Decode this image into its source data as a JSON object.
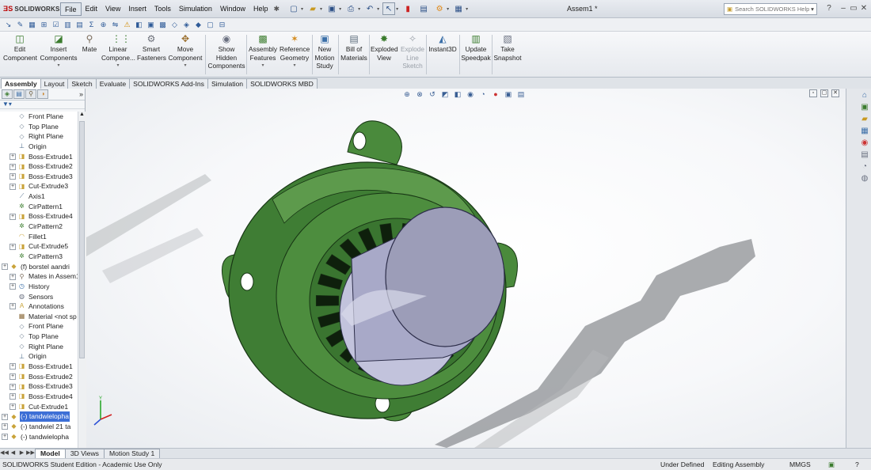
{
  "app": {
    "logo": "SOLIDWORKS",
    "document_title": "Assem1 *"
  },
  "menu": [
    "File",
    "Edit",
    "View",
    "Insert",
    "Tools",
    "Simulation",
    "Window",
    "Help"
  ],
  "search": {
    "placeholder": "Search SOLIDWORKS Help"
  },
  "command_manager": {
    "edit_component": "Edit Component",
    "insert_components": "Insert Components",
    "mate": "Mate",
    "linear_component": "Linear Compone...",
    "smart_fasteners": "Smart Fasteners",
    "move_component": "Move Component",
    "show_hidden": "Show Hidden Components",
    "assembly_features": "Assembly Features",
    "reference_geometry": "Reference Geometry",
    "new_motion_study": "New Motion Study",
    "bill_of_materials": "Bill of Materials",
    "exploded_view": "Exploded View",
    "explode_line_sketch": "Explode Line Sketch",
    "instant3d": "Instant3D",
    "update_speedpak": "Update Speedpak",
    "take_snapshot": "Take Snapshot"
  },
  "tabs": [
    "Assembly",
    "Layout",
    "Sketch",
    "Evaluate",
    "SOLIDWORKS Add-Ins",
    "Simulation",
    "SOLIDWORKS MBD"
  ],
  "tree": [
    {
      "label": "Front Plane",
      "icon": "plane-icon",
      "exp": false
    },
    {
      "label": "Top Plane",
      "icon": "plane-icon",
      "exp": false
    },
    {
      "label": "Right Plane",
      "icon": "plane-icon",
      "exp": false
    },
    {
      "label": "Origin",
      "icon": "origin-icon",
      "exp": false
    },
    {
      "label": "Boss-Extrude1",
      "icon": "feature-icon",
      "exp": true
    },
    {
      "label": "Boss-Extrude2",
      "icon": "feature-icon",
      "exp": true
    },
    {
      "label": "Boss-Extrude3",
      "icon": "feature-icon",
      "exp": true
    },
    {
      "label": "Cut-Extrude3",
      "icon": "feature-icon",
      "exp": true
    },
    {
      "label": "Axis1",
      "icon": "axis-icon",
      "exp": false
    },
    {
      "label": "CirPattern1",
      "icon": "pattern-icon",
      "exp": false
    },
    {
      "label": "Boss-Extrude4",
      "icon": "feature-icon",
      "exp": true
    },
    {
      "label": "CirPattern2",
      "icon": "pattern-icon",
      "exp": false
    },
    {
      "label": "Fillet1",
      "icon": "fillet-icon",
      "exp": false
    },
    {
      "label": "Cut-Extrude5",
      "icon": "feature-icon",
      "exp": true
    },
    {
      "label": "CirPattern3",
      "icon": "pattern-icon",
      "exp": false
    },
    {
      "label": "(f) borstel aandri",
      "icon": "part-icon",
      "exp": true
    },
    {
      "label": "Mates in Assem1",
      "icon": "mates-icon",
      "exp": true
    },
    {
      "label": "History",
      "icon": "history-icon",
      "exp": true
    },
    {
      "label": "Sensors",
      "icon": "sensor-icon",
      "exp": false
    },
    {
      "label": "Annotations",
      "icon": "annotation-icon",
      "exp": true
    },
    {
      "label": "Material <not sp",
      "icon": "material-icon",
      "exp": false
    },
    {
      "label": "Front Plane",
      "icon": "plane-icon",
      "exp": false
    },
    {
      "label": "Top Plane",
      "icon": "plane-icon",
      "exp": false
    },
    {
      "label": "Right Plane",
      "icon": "plane-icon",
      "exp": false
    },
    {
      "label": "Origin",
      "icon": "origin-icon",
      "exp": false
    },
    {
      "label": "Boss-Extrude1",
      "icon": "feature-icon",
      "exp": true
    },
    {
      "label": "Boss-Extrude2",
      "icon": "feature-icon",
      "exp": true
    },
    {
      "label": "Boss-Extrude3",
      "icon": "feature-icon",
      "exp": true
    },
    {
      "label": "Boss-Extrude4",
      "icon": "feature-icon",
      "exp": true
    },
    {
      "label": "Cut-Extrude1",
      "icon": "feature-icon",
      "exp": true
    },
    {
      "label": "(-) tandwielopha",
      "icon": "part-icon",
      "exp": true,
      "selected": true
    },
    {
      "label": "(-) tandwiel 21 ta",
      "icon": "part-icon",
      "exp": true
    },
    {
      "label": "(-) tandwielopha",
      "icon": "part-icon",
      "exp": true
    }
  ],
  "bottom_tabs": [
    "Model",
    "3D Views",
    "Motion Study 1"
  ],
  "status": {
    "edition": "SOLIDWORKS Student Edition - Academic Use Only",
    "definition": "Under Defined",
    "mode": "Editing Assembly",
    "units": "MMGS"
  },
  "colors": {
    "part_green": "#3f7d34",
    "shaft_gray": "#a8a9c8",
    "selection_blue": "#3d6fd6"
  }
}
